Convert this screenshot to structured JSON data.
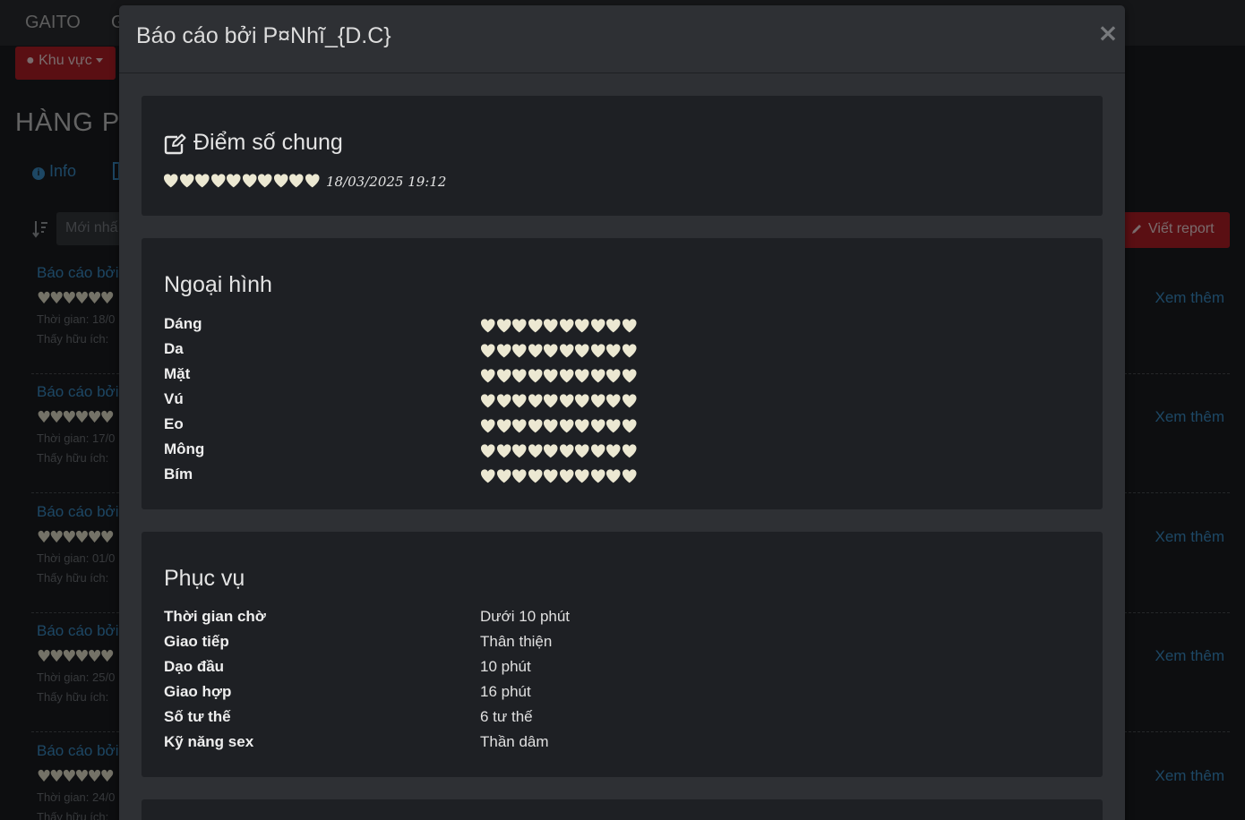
{
  "background": {
    "navbar": {
      "brand": "GAITO",
      "item2": "G"
    },
    "region_button": "Khu vực",
    "heading": "HÀNG PH",
    "tabs": [
      {
        "label": "Info"
      }
    ],
    "sort_placeholder": "Mới nhấ",
    "write_report_button": "Viết report",
    "items": [
      {
        "title": "Báo cáo bởi",
        "hearts": "♥♥♥♥♥♥",
        "time": "Thời gian: 18/0",
        "useful": "Thấy hữu ích: ",
        "more": "Xem thêm"
      },
      {
        "title": "Báo cáo bởi",
        "hearts": "♥♥♥♥♥♥",
        "time": "Thời gian: 17/0",
        "useful": "Thấy hữu ích: ",
        "more": "Xem thêm"
      },
      {
        "title": "Báo cáo bởi",
        "hearts": "♥♥♥♥♥♥",
        "time": "Thời gian: 01/0",
        "useful": "Thấy hữu ích: ",
        "more": "Xem thêm"
      },
      {
        "title": "Báo cáo bởi",
        "hearts": "♥♥♥♥♥♥",
        "time": "Thời gian: 25/0",
        "useful": "Thấy hữu ích: ",
        "more": "Xem thêm"
      },
      {
        "title": "Báo cáo bởi",
        "hearts": "♥♥♥♥♥♥",
        "time": "Thời gian: 24/0",
        "useful": "Thấy hữu ích: ",
        "more": "Xem thêm"
      }
    ]
  },
  "modal": {
    "title": "Báo cáo bởi P¤Nhĩ_{D.C}",
    "close_label": "×",
    "overall": {
      "title": "Điểm số chung",
      "rating": 10,
      "max_rating": 10,
      "date": "18/03/2025 19:12"
    },
    "appearance": {
      "title": "Ngoại hình",
      "rows": [
        {
          "label": "Dáng",
          "rating": 10
        },
        {
          "label": "Da",
          "rating": 10
        },
        {
          "label": "Mặt",
          "rating": 10
        },
        {
          "label": "Vú",
          "rating": 10
        },
        {
          "label": "Eo",
          "rating": 10
        },
        {
          "label": "Mông",
          "rating": 10
        },
        {
          "label": "Bím",
          "rating": 10
        }
      ]
    },
    "service": {
      "title": "Phục vụ",
      "rows": [
        {
          "label": "Thời gian chờ",
          "value": "Dưới 10 phút"
        },
        {
          "label": "Giao tiếp",
          "value": "Thân thiện"
        },
        {
          "label": "Dạo đầu",
          "value": "10 phút"
        },
        {
          "label": "Giao hợp",
          "value": "16 phút"
        },
        {
          "label": "Số tư thế",
          "value": "6 tư thế"
        },
        {
          "label": "Kỹ năng sex",
          "value": "Thần dâm"
        }
      ]
    }
  },
  "colors": {
    "heart": "#ece8d2",
    "accent_red": "#b51f27",
    "link_blue": "#3a8ec9"
  }
}
